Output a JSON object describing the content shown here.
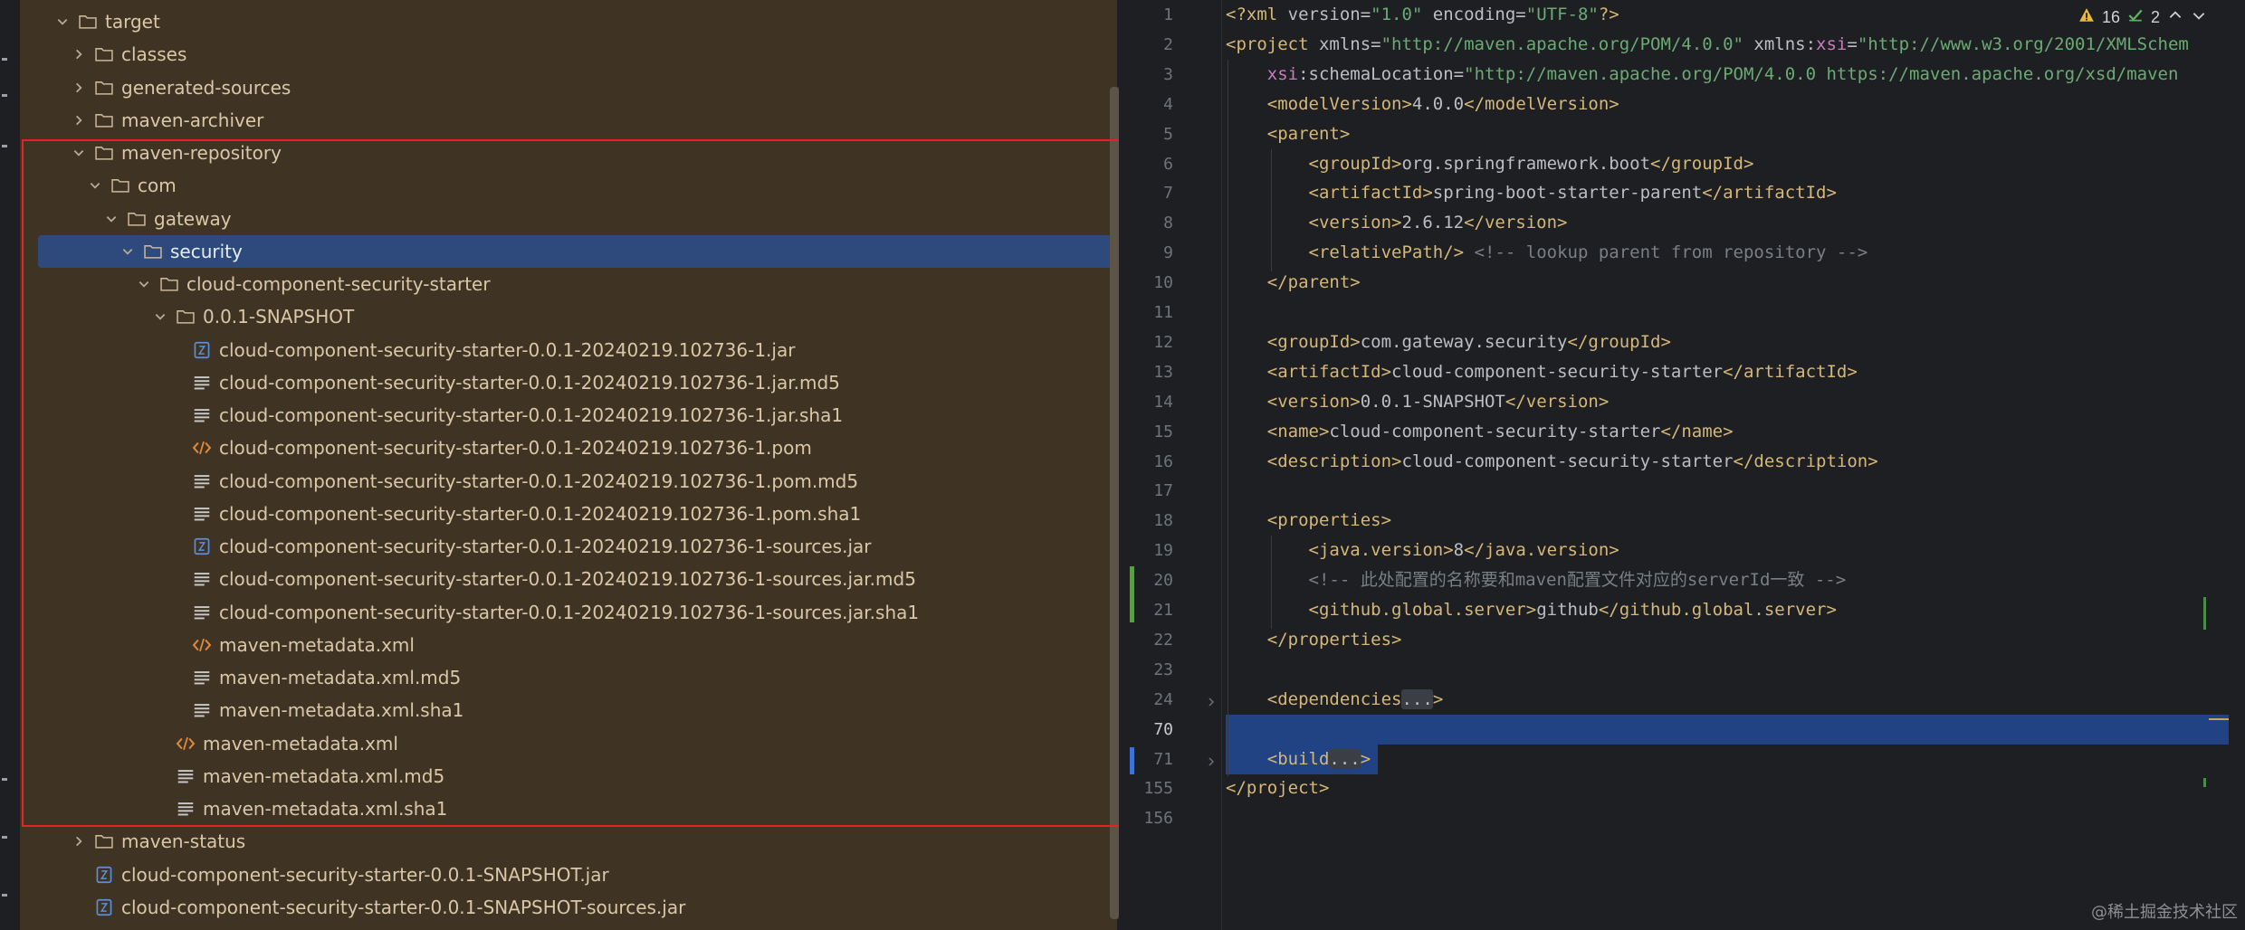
{
  "project_tree": {
    "rows": [
      {
        "label": "target",
        "depth": 1,
        "type": "folder",
        "expanded": true
      },
      {
        "label": "classes",
        "depth": 2,
        "type": "folder",
        "expanded": false
      },
      {
        "label": "generated-sources",
        "depth": 2,
        "type": "folder",
        "expanded": false
      },
      {
        "label": "maven-archiver",
        "depth": 2,
        "type": "folder",
        "expanded": false
      },
      {
        "label": "maven-repository",
        "depth": 2,
        "type": "folder",
        "expanded": true
      },
      {
        "label": "com",
        "depth": 3,
        "type": "folder",
        "expanded": true
      },
      {
        "label": "gateway",
        "depth": 4,
        "type": "folder",
        "expanded": true
      },
      {
        "label": "security",
        "depth": 5,
        "type": "folder",
        "expanded": true,
        "selected": true
      },
      {
        "label": "cloud-component-security-starter",
        "depth": 6,
        "type": "folder",
        "expanded": true
      },
      {
        "label": "0.0.1-SNAPSHOT",
        "depth": 7,
        "type": "folder",
        "expanded": true
      },
      {
        "label": "cloud-component-security-starter-0.0.1-20240219.102736-1.jar",
        "depth": 8,
        "type": "jar"
      },
      {
        "label": "cloud-component-security-starter-0.0.1-20240219.102736-1.jar.md5",
        "depth": 8,
        "type": "text"
      },
      {
        "label": "cloud-component-security-starter-0.0.1-20240219.102736-1.jar.sha1",
        "depth": 8,
        "type": "text"
      },
      {
        "label": "cloud-component-security-starter-0.0.1-20240219.102736-1.pom",
        "depth": 8,
        "type": "xml"
      },
      {
        "label": "cloud-component-security-starter-0.0.1-20240219.102736-1.pom.md5",
        "depth": 8,
        "type": "text"
      },
      {
        "label": "cloud-component-security-starter-0.0.1-20240219.102736-1.pom.sha1",
        "depth": 8,
        "type": "text"
      },
      {
        "label": "cloud-component-security-starter-0.0.1-20240219.102736-1-sources.jar",
        "depth": 8,
        "type": "jar"
      },
      {
        "label": "cloud-component-security-starter-0.0.1-20240219.102736-1-sources.jar.md5",
        "depth": 8,
        "type": "text"
      },
      {
        "label": "cloud-component-security-starter-0.0.1-20240219.102736-1-sources.jar.sha1",
        "depth": 8,
        "type": "text"
      },
      {
        "label": "maven-metadata.xml",
        "depth": 8,
        "type": "xml"
      },
      {
        "label": "maven-metadata.xml.md5",
        "depth": 8,
        "type": "text"
      },
      {
        "label": "maven-metadata.xml.sha1",
        "depth": 8,
        "type": "text"
      },
      {
        "label": "maven-metadata.xml",
        "depth": 7,
        "type": "xml"
      },
      {
        "label": "maven-metadata.xml.md5",
        "depth": 7,
        "type": "text"
      },
      {
        "label": "maven-metadata.xml.sha1",
        "depth": 7,
        "type": "text"
      },
      {
        "label": "maven-status",
        "depth": 2,
        "type": "folder",
        "expanded": false
      },
      {
        "label": "cloud-component-security-starter-0.0.1-SNAPSHOT.jar",
        "depth": 2,
        "type": "jar"
      },
      {
        "label": "cloud-component-security-starter-0.0.1-SNAPSHOT-sources.jar",
        "depth": 2,
        "type": "jar"
      }
    ]
  },
  "inspections": {
    "warnings": "16",
    "ok": "2"
  },
  "editor": {
    "lines": [
      {
        "n": "1",
        "html": "<span class='t-tag'>&lt;?xml </span><span class='t-attr'>version=</span><span class='t-str'>\"1.0\"</span><span class='t-attr'> encoding=</span><span class='t-str'>\"UTF-8\"</span><span class='t-tag'>?&gt;</span>"
      },
      {
        "n": "2",
        "html": "<span class='t-tag'>&lt;project </span><span class='t-attr'>xmlns=</span><span class='t-str'>\"http://maven.apache.org/POM/4.0.0\"</span><span class='t-attr'> xmlns:</span><span class='t-ns'>xsi</span><span class='t-attr'>=</span><span class='t-str'>\"http://www.w3.org/2001/XMLSchem</span>"
      },
      {
        "n": "3",
        "html": "    <span class='t-ns'>xsi</span><span class='t-attr'>:schemaLocation=</span><span class='t-str'>\"http://maven.apache.org/POM/4.0.0 https://maven.apache.org/xsd/maven</span>"
      },
      {
        "n": "4",
        "html": "    <span class='t-tag'>&lt;modelVersion&gt;</span>4.0.0<span class='t-tag'>&lt;/modelVersion&gt;</span>"
      },
      {
        "n": "5",
        "html": "    <span class='t-tag'>&lt;parent&gt;</span>"
      },
      {
        "n": "6",
        "html": "        <span class='t-tag'>&lt;groupId&gt;</span>org.springframework.boot<span class='t-tag'>&lt;/groupId&gt;</span>"
      },
      {
        "n": "7",
        "html": "        <span class='t-tag'>&lt;artifactId&gt;</span>spring-boot-starter-parent<span class='t-tag'>&lt;/artifactId&gt;</span>"
      },
      {
        "n": "8",
        "html": "        <span class='t-tag'>&lt;version&gt;</span>2.6.12<span class='t-tag'>&lt;/version&gt;</span>"
      },
      {
        "n": "9",
        "html": "        <span class='t-tag'>&lt;relativePath/&gt;</span> <span class='t-cmt'>&lt;!-- lookup parent from repository --&gt;</span>"
      },
      {
        "n": "10",
        "html": "    <span class='t-tag'>&lt;/parent&gt;</span>"
      },
      {
        "n": "11",
        "html": ""
      },
      {
        "n": "12",
        "html": "    <span class='t-tag'>&lt;groupId&gt;</span>com.gateway.security<span class='t-tag'>&lt;/groupId&gt;</span>"
      },
      {
        "n": "13",
        "html": "    <span class='t-tag'>&lt;artifactId&gt;</span>cloud-component-security-starter<span class='t-tag'>&lt;/artifactId&gt;</span>"
      },
      {
        "n": "14",
        "html": "    <span class='t-tag'>&lt;version&gt;</span>0.0.1-SNAPSHOT<span class='t-tag'>&lt;/version&gt;</span>"
      },
      {
        "n": "15",
        "html": "    <span class='t-tag'>&lt;name&gt;</span>cloud-component-security-starter<span class='t-tag'>&lt;/name&gt;</span>"
      },
      {
        "n": "16",
        "html": "    <span class='t-tag'>&lt;description&gt;</span>cloud-component-security-starter<span class='t-tag'>&lt;/description&gt;</span>"
      },
      {
        "n": "17",
        "html": ""
      },
      {
        "n": "18",
        "html": "    <span class='t-tag'>&lt;properties&gt;</span>"
      },
      {
        "n": "19",
        "html": "        <span class='t-tag'>&lt;java.version&gt;</span>8<span class='t-tag'>&lt;/java.version&gt;</span>"
      },
      {
        "n": "20",
        "html": "        <span class='t-cmt'>&lt;!-- 此处配置的名称要和maven配置文件对应的serverId一致 --&gt;</span>"
      },
      {
        "n": "21",
        "html": "        <span class='t-tag'>&lt;github.global.server&gt;</span>github<span class='t-tag'>&lt;/github.global.server&gt;</span>"
      },
      {
        "n": "22",
        "html": "    <span class='t-tag'>&lt;/properties&gt;</span>"
      },
      {
        "n": "23",
        "html": ""
      },
      {
        "n": "24",
        "html": "    <span class='t-tag'>&lt;dependencies</span><span class='t-fold'>...</span><span class='t-tag'>&gt;</span>"
      },
      {
        "n": "70",
        "html": ""
      },
      {
        "n": "71",
        "html": "    <span class='t-tag'>&lt;build</span><span class='t-fold'>...</span><span class='t-tag'>&gt;</span>"
      },
      {
        "n": "155",
        "html": "<span class='t-tag'>&lt;/project&gt;</span>"
      },
      {
        "n": "156",
        "html": ""
      }
    ]
  },
  "watermark": "@稀土掘金技术社区",
  "colors": {
    "highlight_box": "#e5222a",
    "selection": "#2e4a7d",
    "panel_bg": "#3f3424"
  }
}
